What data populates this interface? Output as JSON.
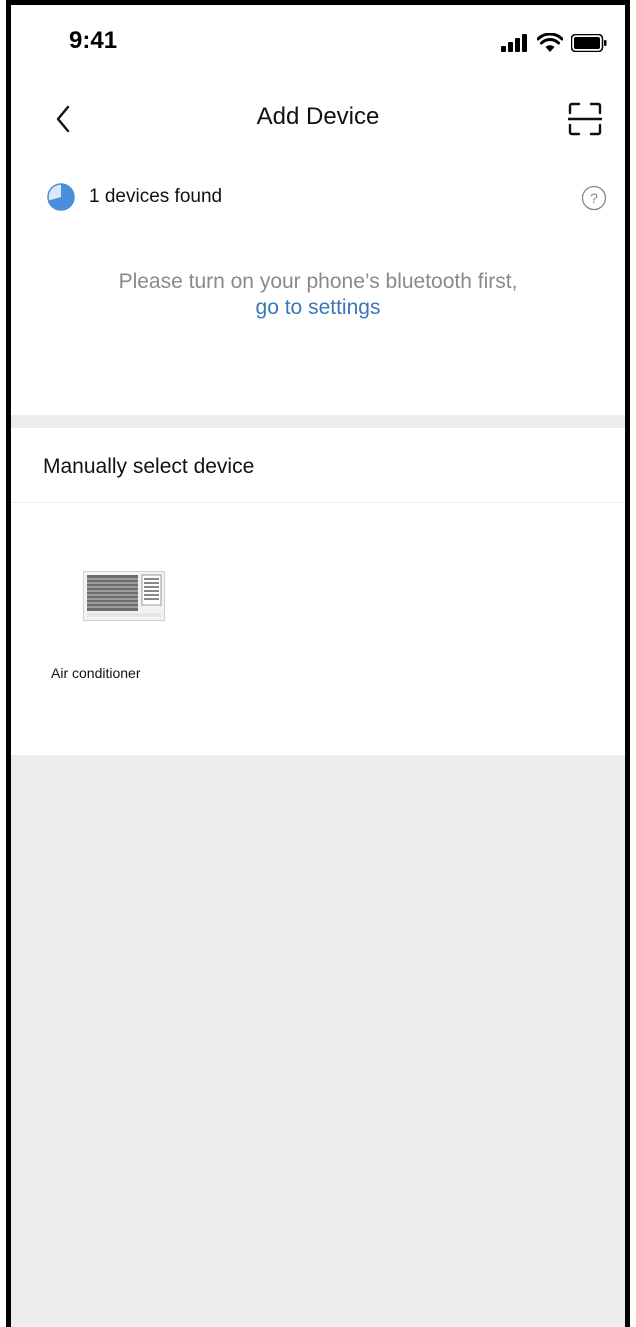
{
  "status_bar": {
    "time": "9:41",
    "icons": [
      "signal-icon",
      "wifi-icon",
      "battery-icon"
    ]
  },
  "nav": {
    "title": "Add Device",
    "back_icon": "chevron-left-icon",
    "scan_icon": "scan-icon"
  },
  "scan": {
    "found_text": "1 devices found",
    "help_icon": "question-circle-icon"
  },
  "bluetooth": {
    "message": "Please turn on your phone’s bluetooth first,",
    "link": "go to settings"
  },
  "manual": {
    "title": "Manually select device",
    "devices": [
      {
        "label": "Air conditioner",
        "icon": "air-conditioner-icon"
      }
    ]
  },
  "colors": {
    "link": "#3a77b5",
    "progress": "#4a8fd9",
    "background": "#ededed"
  }
}
